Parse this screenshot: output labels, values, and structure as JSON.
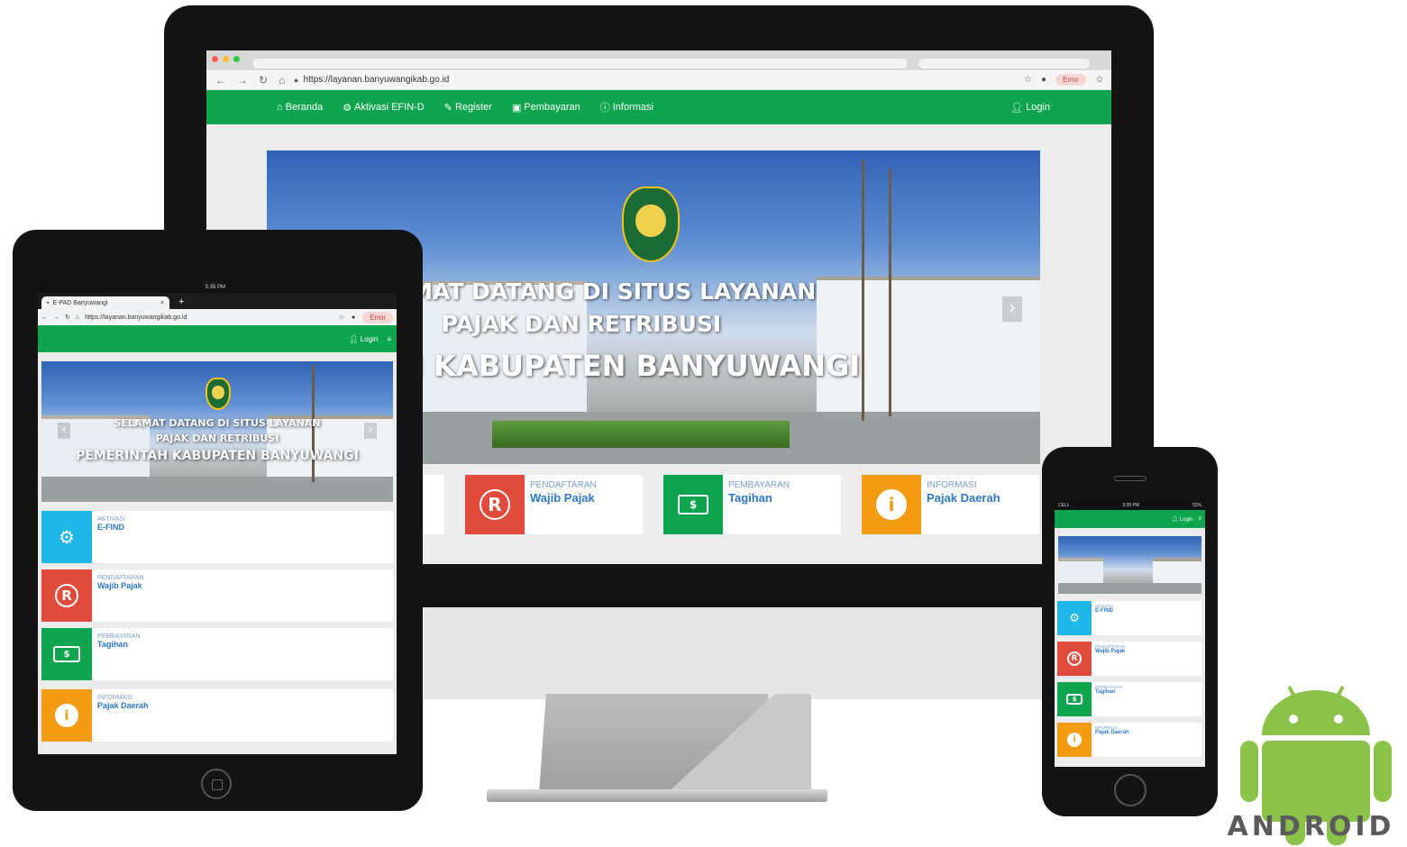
{
  "colors": {
    "green": "#0fa44e",
    "aktivasi": "#1eb7e8",
    "pendaftaran": "#e14b3c",
    "pembayaran": "#0fa44e",
    "informasi": "#f39b12",
    "link": "#2e78c8"
  },
  "desktop": {
    "url": "https://layanan.banyuwangikab.go.id",
    "error_label": "Error",
    "nav": {
      "beranda": "Beranda",
      "aktivasi": "Aktivasi EFIN-D",
      "register": "Register",
      "pembayaran": "Pembayaran",
      "informasi": "Informasi",
      "login": "Login"
    },
    "hero": {
      "line1": "SELAMAT DATANG DI SITUS LAYANAN",
      "line2": "PAJAK DAN RETRIBUSI",
      "line3": "RINTAH KABUPATEN BANYUWANGI"
    },
    "cards": [
      {
        "category": "PENDAFTARAN",
        "name": "Wajib Pajak",
        "icon": "registered-icon"
      },
      {
        "category": "PEMBAYARAN",
        "name": "Tagihan",
        "icon": "money-icon"
      },
      {
        "category": "INFORMASI",
        "name": "Pajak Daerah",
        "icon": "info-icon"
      }
    ]
  },
  "tablet": {
    "status_left": "",
    "status_time": "5:35 PM",
    "tab_title": "E-PAD Banyuwangi",
    "url": "https://layanan.banyuwangikab.go.id",
    "error_label": "Error",
    "login": "Login",
    "hero": {
      "line1": "SELAMAT DATANG DI SITUS LAYANAN",
      "line2": "PAJAK DAN RETRIBUSI",
      "line3": "PEMERINTAH KABUPATEN BANYUWANGI"
    },
    "cards": [
      {
        "category": "AKTIVASI",
        "name": "E-FIND",
        "icon": "gear-icon"
      },
      {
        "category": "PENDAFTARAN",
        "name": "Wajib Pajak",
        "icon": "registered-icon"
      },
      {
        "category": "PEMBAYARAN",
        "name": "Tagihan",
        "icon": "money-icon"
      },
      {
        "category": "INFORMASI",
        "name": "Pajak Daerah",
        "icon": "info-icon"
      }
    ]
  },
  "phone": {
    "carrier": "CELL",
    "time": "3:35 PM",
    "battery": "52%",
    "login": "Login",
    "cards": [
      {
        "category": "AKTIVASI",
        "name": "E-FIND",
        "icon": "gear-icon"
      },
      {
        "category": "PENDAFTARAN",
        "name": "Wajib Pajak",
        "icon": "registered-icon"
      },
      {
        "category": "PEMBAYARAN",
        "name": "Tagihan",
        "icon": "money-icon"
      },
      {
        "category": "INFORMASI",
        "name": "Pajak Daerah",
        "icon": "info-icon"
      }
    ]
  },
  "android_wordmark": "ANDROID"
}
